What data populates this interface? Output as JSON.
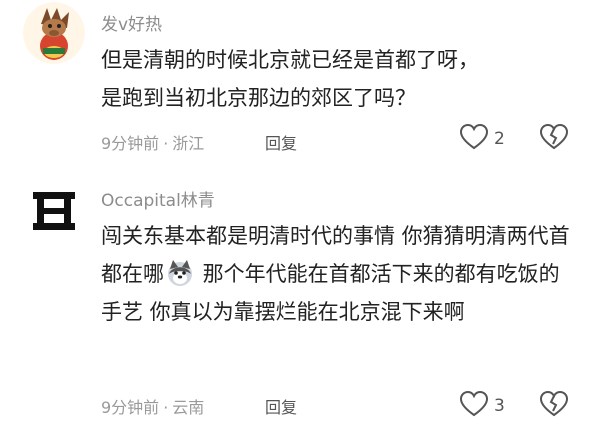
{
  "comments": [
    {
      "username": "发v好热",
      "lines": [
        "但是清朝的时候北京就已经是首都了呀，",
        "是跑到当初北京那边的郊区了吗？"
      ],
      "time": "9分钟前",
      "location": "浙江",
      "reply_label": "回复",
      "likes": "2",
      "avatar_icon": "horse-avatar-icon"
    },
    {
      "username": "Occapital林青",
      "text_a": "闯关东基本都是明清时代的事情 你猜猜明清两代首都在哪",
      "text_b": " 那个年代能在首都活下来的都有吃饭的手艺 你真以为靠摆烂能在北京混下来啊",
      "time": "9分钟前",
      "location": "云南",
      "reply_label": "回复",
      "likes": "3",
      "avatar_icon": "h-logo-avatar-icon",
      "emoji": "husky-dog-emoji"
    }
  ],
  "separator": "·"
}
